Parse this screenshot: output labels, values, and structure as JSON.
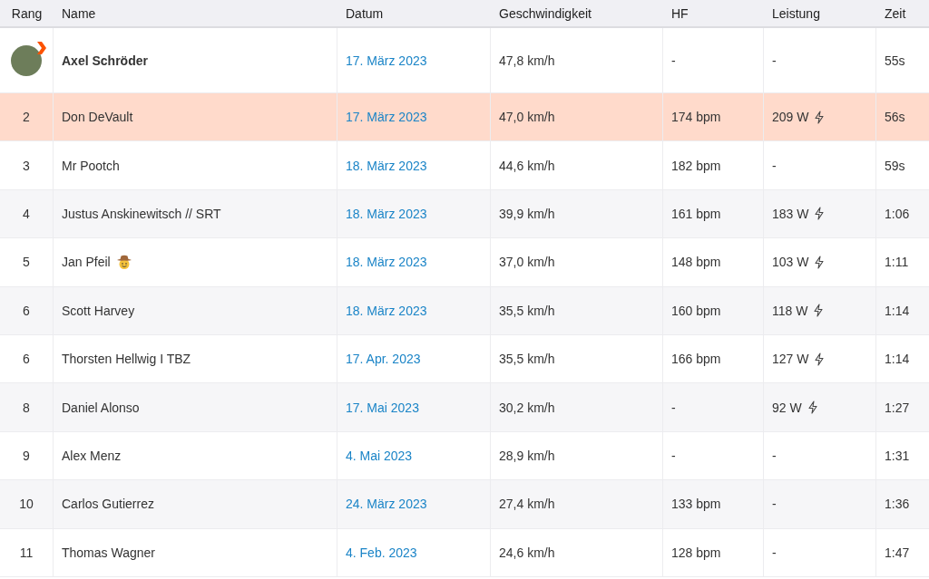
{
  "table": {
    "columns": [
      "Rang",
      "Name",
      "Datum",
      "Geschwindigkeit",
      "HF",
      "Leistung",
      "Zeit"
    ],
    "rows": [
      {
        "kind": "leader",
        "rank": "",
        "name": "Axel Schröder",
        "date": "17. März 2023",
        "speed": "47,8 km/h",
        "hf": "-",
        "power": "-",
        "bolt": false,
        "emoji": false,
        "highlighted": false,
        "time": "55s"
      },
      {
        "kind": "plain",
        "rank": "2",
        "name": "Don DeVault",
        "date": "17. März 2023",
        "speed": "47,0 km/h",
        "hf": "174 bpm",
        "power": "209 W",
        "bolt": true,
        "emoji": false,
        "highlighted": true,
        "time": "56s"
      },
      {
        "kind": "plain",
        "rank": "3",
        "name": "Mr Pootch",
        "date": "18. März 2023",
        "speed": "44,6 km/h",
        "hf": "182 bpm",
        "power": "-",
        "bolt": false,
        "emoji": false,
        "highlighted": false,
        "time": "59s"
      },
      {
        "kind": "plain",
        "rank": "4",
        "name": "Justus Anskinewitsch // SRT",
        "date": "18. März 2023",
        "speed": "39,9 km/h",
        "hf": "161 bpm",
        "power": "183 W",
        "bolt": true,
        "emoji": false,
        "highlighted": false,
        "time": "1:06"
      },
      {
        "kind": "plain",
        "rank": "5",
        "name": "Jan Pfeil",
        "date": "18. März 2023",
        "speed": "37,0 km/h",
        "hf": "148 bpm",
        "power": "103 W",
        "bolt": true,
        "emoji": true,
        "highlighted": false,
        "time": "1:11"
      },
      {
        "kind": "plain",
        "rank": "6",
        "name": "Scott Harvey",
        "date": "18. März 2023",
        "speed": "35,5 km/h",
        "hf": "160 bpm",
        "power": "118 W",
        "bolt": true,
        "emoji": false,
        "highlighted": false,
        "time": "1:14"
      },
      {
        "kind": "plain",
        "rank": "6",
        "name": "Thorsten Hellwig I TBZ",
        "date": "17. Apr. 2023",
        "speed": "35,5 km/h",
        "hf": "166 bpm",
        "power": "127 W",
        "bolt": true,
        "emoji": false,
        "highlighted": false,
        "time": "1:14"
      },
      {
        "kind": "plain",
        "rank": "8",
        "name": "Daniel Alonso",
        "date": "17. Mai 2023",
        "speed": "30,2 km/h",
        "hf": "-",
        "power": "92 W",
        "bolt": true,
        "emoji": false,
        "highlighted": false,
        "time": "1:27"
      },
      {
        "kind": "plain",
        "rank": "9",
        "name": "Alex Menz",
        "date": "4. Mai 2023",
        "speed": "28,9 km/h",
        "hf": "-",
        "power": "-",
        "bolt": false,
        "emoji": false,
        "highlighted": false,
        "time": "1:31"
      },
      {
        "kind": "plain",
        "rank": "10",
        "name": "Carlos Gutierrez",
        "date": "24. März 2023",
        "speed": "27,4 km/h",
        "hf": "133 bpm",
        "power": "-",
        "bolt": false,
        "emoji": false,
        "highlighted": false,
        "time": "1:36"
      },
      {
        "kind": "plain",
        "rank": "11",
        "name": "Thomas Wagner",
        "date": "4. Feb. 2023",
        "speed": "24,6 km/h",
        "hf": "128 bpm",
        "power": "-",
        "bolt": false,
        "emoji": false,
        "highlighted": false,
        "time": "1:47"
      }
    ]
  }
}
